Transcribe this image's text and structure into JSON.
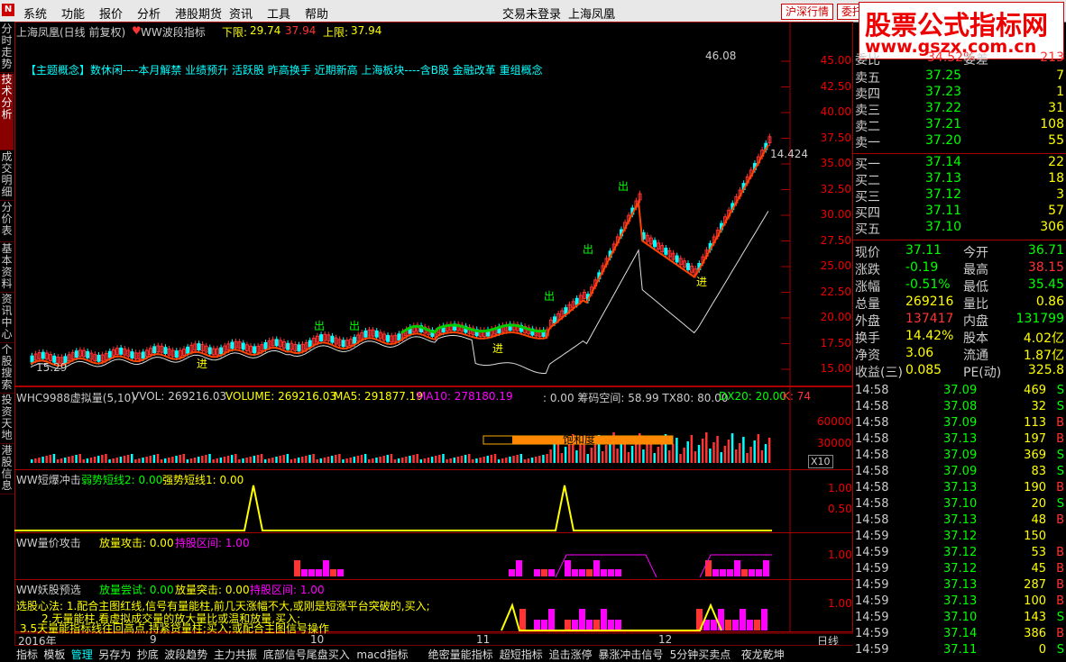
{
  "menubar": {
    "items": [
      "系统",
      "功能",
      "报价",
      "分析",
      "港股期货",
      "资讯",
      "工具",
      "帮助"
    ],
    "status": "交易未登录",
    "stock": "上海凤凰",
    "btn1": "沪深行情",
    "btn2": "委托"
  },
  "watermark": {
    "line1": "股票公式指标网",
    "line2": "www.gszx.com.cn"
  },
  "left_tabs": [
    "分时走势",
    "技术分析",
    "成交明细",
    "分价表",
    "基本资料",
    "资讯中心",
    "个股搜索",
    "投资天地",
    "港股信息"
  ],
  "main_chart": {
    "title": "上海凤凰(日线 前复权)",
    "indicator": "WW波段指标",
    "lower_label": "下限:",
    "lower_val": "29.74",
    "mid_val": "37.94",
    "upper_label": "上限:",
    "upper_val": "37.94",
    "concept": "【主题概念】数休闲----本月解禁 业绩预升 活跃股 昨高换手 近期新高 上海板块----含B股 金融改革 重组概念",
    "high_mark": "46.08",
    "low_mark": "15.29",
    "right_mark": "14.424",
    "axis": [
      "45.00",
      "42.50",
      "40.00",
      "37.50",
      "35.00",
      "32.50",
      "30.00",
      "27.50",
      "25.00",
      "22.50",
      "20.00",
      "17.50",
      "15.00"
    ],
    "signal_out": "出",
    "signal_in": "进"
  },
  "vol_panel": {
    "name": "WHC9988虚拟量(5,10)",
    "vvol": "VVOL: 269216.03",
    "volume": "VOLUME: 269216.03",
    "ma5": "MA5: 291877.19",
    "ma10": "MA10: 278180.19",
    "rest": ": 0.00  筹码空间: 58.99  TX80: 80.00",
    "dx20": "DX20: 20.00",
    "k": "K: 74",
    "saturation": "饱和度",
    "axis": [
      "60000",
      "30000"
    ],
    "unit": "X10"
  },
  "panel2": {
    "name": "WW短爆冲击",
    "weak": "弱势短线2: 0.00",
    "strong": "强势短线1: 0.00",
    "axis": [
      "1.00",
      "0.50"
    ]
  },
  "panel3": {
    "name": "WW量价攻击",
    "attack": "放量攻击: 0.00",
    "hold": "持股区间: 1.00",
    "axis": [
      "1.00"
    ]
  },
  "panel4": {
    "name": "WW妖股预选",
    "try": "放量尝试: 0.00",
    "break": "放量突击: 0.00",
    "hold": "持股区间: 1.00",
    "note1": "选股心法: 1.配合主图红线,信号有量能柱,前几天涨幅不大,或刚是短涨平台突破的,买入;",
    "note2": "2.无量能柱,看虚拟成交量的放大量比或温和放量,买入;",
    "note3": "3.5天量能指标线往回高点,持紧贷量柱;买入;或配合主图信号操作",
    "axis": [
      "1.00"
    ]
  },
  "timeline": {
    "labels": [
      "2016年",
      "9",
      "10",
      "11",
      "12"
    ],
    "period": "日线"
  },
  "bottom_tabs": [
    "指标",
    "模板",
    "管理",
    "另存为",
    "抄底",
    "波段趋势",
    "主力共振",
    "底部信号尾盘买入",
    "macd指标",
    "绝密量能指标",
    "超短指标",
    "追击涨停",
    "暴涨冲击信号",
    "5分钟买卖点",
    "夜龙乾坤"
  ],
  "quote": {
    "top": {
      "label1": "委比",
      "val1": "34.52%",
      "label2": "委差",
      "val2": "213"
    },
    "sell": [
      {
        "label": "卖五",
        "price": "37.25",
        "vol": "7"
      },
      {
        "label": "卖四",
        "price": "37.23",
        "vol": "1"
      },
      {
        "label": "卖三",
        "price": "37.22",
        "vol": "31"
      },
      {
        "label": "卖二",
        "price": "37.21",
        "vol": "108"
      },
      {
        "label": "卖一",
        "price": "37.20",
        "vol": "55"
      }
    ],
    "buy": [
      {
        "label": "买一",
        "price": "37.14",
        "vol": "22"
      },
      {
        "label": "买二",
        "price": "37.13",
        "vol": "18"
      },
      {
        "label": "买三",
        "price": "37.12",
        "vol": "3"
      },
      {
        "label": "买四",
        "price": "37.11",
        "vol": "57"
      },
      {
        "label": "买五",
        "price": "37.10",
        "vol": "306"
      }
    ],
    "stats": [
      {
        "l1": "现价",
        "v1": "37.11",
        "l2": "今开",
        "v2": "36.71",
        "c1": "#0f0",
        "c2": "#0f0"
      },
      {
        "l1": "涨跌",
        "v1": "-0.19",
        "l2": "最高",
        "v2": "38.15",
        "c1": "#0f0",
        "c2": "#f33"
      },
      {
        "l1": "涨幅",
        "v1": "-0.51%",
        "l2": "最低",
        "v2": "35.45",
        "c1": "#0f0",
        "c2": "#0f0"
      },
      {
        "l1": "总量",
        "v1": "269216",
        "l2": "量比",
        "v2": "0.86",
        "c1": "#ff0",
        "c2": "#ff0"
      },
      {
        "l1": "外盘",
        "v1": "137417",
        "l2": "内盘",
        "v2": "131799",
        "c1": "#f33",
        "c2": "#0f0"
      },
      {
        "l1": "换手",
        "v1": "14.42%",
        "l2": "股本",
        "v2": "4.02亿",
        "c1": "#ff0",
        "c2": "#ff0"
      },
      {
        "l1": "净资",
        "v1": "3.06",
        "l2": "流通",
        "v2": "1.87亿",
        "c1": "#ff0",
        "c2": "#ff0"
      },
      {
        "l1": "收益(三)",
        "v1": "0.085",
        "l2": "PE(动)",
        "v2": "325.8",
        "c1": "#ff0",
        "c2": "#ff0"
      }
    ]
  },
  "ticks": [
    {
      "t": "14:58",
      "p": "37.09",
      "v": "469",
      "s": "S"
    },
    {
      "t": "14:58",
      "p": "37.08",
      "v": "32",
      "s": "S"
    },
    {
      "t": "14:58",
      "p": "37.09",
      "v": "113",
      "s": "B"
    },
    {
      "t": "14:58",
      "p": "37.13",
      "v": "197",
      "s": "B"
    },
    {
      "t": "14:58",
      "p": "37.09",
      "v": "369",
      "s": "S"
    },
    {
      "t": "14:58",
      "p": "37.09",
      "v": "83",
      "s": "S"
    },
    {
      "t": "14:58",
      "p": "37.13",
      "v": "190",
      "s": "B"
    },
    {
      "t": "14:58",
      "p": "37.10",
      "v": "20",
      "s": "S"
    },
    {
      "t": "14:58",
      "p": "37.13",
      "v": "48",
      "s": "B"
    },
    {
      "t": "14:59",
      "p": "37.12",
      "v": "150",
      "s": ""
    },
    {
      "t": "14:59",
      "p": "37.12",
      "v": "53",
      "s": "B"
    },
    {
      "t": "14:59",
      "p": "37.12",
      "v": "45",
      "s": "B"
    },
    {
      "t": "14:59",
      "p": "37.13",
      "v": "287",
      "s": "B"
    },
    {
      "t": "14:59",
      "p": "37.13",
      "v": "100",
      "s": "B"
    },
    {
      "t": "14:59",
      "p": "37.10",
      "v": "143",
      "s": "S"
    },
    {
      "t": "14:59",
      "p": "37.14",
      "v": "386",
      "s": "B"
    },
    {
      "t": "14:59",
      "p": "37.11",
      "v": "0",
      "s": "S"
    }
  ],
  "colors": {
    "up": "#f33",
    "down": "#0ff",
    "red_line": "#f40",
    "panel_border": "#a00"
  }
}
